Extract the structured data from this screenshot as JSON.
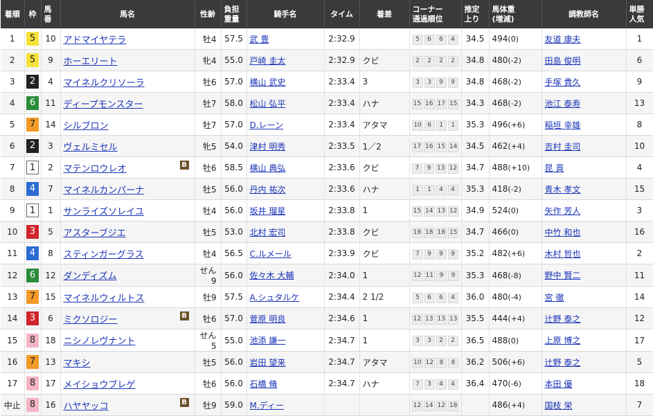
{
  "headers": {
    "rank": "着順",
    "waku": "枠",
    "num": [
      "馬",
      "番"
    ],
    "horse": "馬名",
    "sexage": "性齢",
    "weight": [
      "負担",
      "重量"
    ],
    "jockey": "騎手名",
    "time": "タイム",
    "margin": "着差",
    "corner": [
      "コーナー",
      "通過順位"
    ],
    "last3f": [
      "推定",
      "上り"
    ],
    "bodyw": [
      "馬体重",
      "(増減)"
    ],
    "trainer": "調教師名",
    "pop": [
      "単勝",
      "人気"
    ]
  },
  "blinker_label": "B",
  "rows": [
    {
      "rank": "1",
      "waku": "5",
      "num": "10",
      "horse": "アドマイヤテラ",
      "blinker": false,
      "sexage": "牡4",
      "weight": "57.5",
      "jockey": "武 豊",
      "time": "2:32.9",
      "margin": "",
      "corner": [
        "5",
        "6",
        "6",
        "4"
      ],
      "last3f": "34.5",
      "bodyw": "494",
      "bodyw_diff": "(0)",
      "trainer": "友道 康夫",
      "pop": "1"
    },
    {
      "rank": "2",
      "waku": "5",
      "num": "9",
      "horse": "ホーエリート",
      "blinker": false,
      "sexage": "牝4",
      "weight": "55.0",
      "jockey": "戸崎 圭太",
      "time": "2:32.9",
      "margin": "クビ",
      "corner": [
        "2",
        "2",
        "2",
        "2"
      ],
      "last3f": "34.8",
      "bodyw": "480",
      "bodyw_diff": "(-2)",
      "trainer": "田島 俊明",
      "pop": "6"
    },
    {
      "rank": "3",
      "waku": "2",
      "num": "4",
      "horse": "マイネルクリソーラ",
      "blinker": false,
      "sexage": "牡6",
      "weight": "57.0",
      "jockey": "横山 武史",
      "time": "2:33.4",
      "margin": "3",
      "corner": [
        "3",
        "3",
        "9",
        "9"
      ],
      "last3f": "34.8",
      "bodyw": "468",
      "bodyw_diff": "(-2)",
      "trainer": "手塚 貴久",
      "pop": "9"
    },
    {
      "rank": "4",
      "waku": "6",
      "num": "11",
      "horse": "ディープモンスター",
      "blinker": false,
      "sexage": "牡7",
      "weight": "58.0",
      "jockey": "松山 弘平",
      "time": "2:33.4",
      "margin": "ハナ",
      "corner": [
        "15",
        "16",
        "17",
        "15"
      ],
      "last3f": "34.3",
      "bodyw": "468",
      "bodyw_diff": "(-2)",
      "trainer": "池江 泰寿",
      "pop": "13"
    },
    {
      "rank": "5",
      "waku": "7",
      "num": "14",
      "horse": "シルブロン",
      "blinker": false,
      "sexage": "牡7",
      "weight": "57.0",
      "jockey": "D.レーン",
      "time": "2:33.4",
      "margin": "アタマ",
      "corner": [
        "10",
        "6",
        "1",
        "1"
      ],
      "last3f": "35.3",
      "bodyw": "496",
      "bodyw_diff": "(+6)",
      "trainer": "稲垣 幸雄",
      "pop": "8"
    },
    {
      "rank": "6",
      "waku": "2",
      "num": "3",
      "horse": "ヴェルミセル",
      "blinker": false,
      "sexage": "牝5",
      "weight": "54.0",
      "jockey": "津村 明秀",
      "time": "2:33.5",
      "margin": "1／2",
      "corner": [
        "17",
        "16",
        "15",
        "14"
      ],
      "last3f": "34.5",
      "bodyw": "462",
      "bodyw_diff": "(+4)",
      "trainer": "吉村 圭司",
      "pop": "10"
    },
    {
      "rank": "7",
      "waku": "1",
      "num": "2",
      "horse": "マテンロウレオ",
      "blinker": true,
      "sexage": "牡6",
      "weight": "58.5",
      "jockey": "横山 典弘",
      "time": "2:33.6",
      "margin": "クビ",
      "corner": [
        "7",
        "9",
        "13",
        "12"
      ],
      "last3f": "34.7",
      "bodyw": "488",
      "bodyw_diff": "(+10)",
      "trainer": "昆 貢",
      "pop": "4"
    },
    {
      "rank": "8",
      "waku": "4",
      "num": "7",
      "horse": "マイネルカンパーナ",
      "blinker": false,
      "sexage": "牡5",
      "weight": "56.0",
      "jockey": "丹内 祐次",
      "time": "2:33.6",
      "margin": "ハナ",
      "corner": [
        "1",
        "1",
        "4",
        "4"
      ],
      "last3f": "35.3",
      "bodyw": "418",
      "bodyw_diff": "(-2)",
      "trainer": "青木 孝文",
      "pop": "15"
    },
    {
      "rank": "9",
      "waku": "1",
      "num": "1",
      "horse": "サンライズソレイユ",
      "blinker": false,
      "sexage": "牡4",
      "weight": "56.0",
      "jockey": "坂井 瑠星",
      "time": "2:33.8",
      "margin": "1",
      "corner": [
        "15",
        "14",
        "13",
        "12"
      ],
      "last3f": "34.9",
      "bodyw": "524",
      "bodyw_diff": "(0)",
      "trainer": "矢作 芳人",
      "pop": "3"
    },
    {
      "rank": "10",
      "waku": "3",
      "num": "5",
      "horse": "アスターブジエ",
      "blinker": false,
      "sexage": "牡5",
      "weight": "53.0",
      "jockey": "北村 宏司",
      "time": "2:33.8",
      "margin": "クビ",
      "corner": [
        "18",
        "18",
        "18",
        "15"
      ],
      "last3f": "34.7",
      "bodyw": "466",
      "bodyw_diff": "(0)",
      "trainer": "中竹 和也",
      "pop": "16"
    },
    {
      "rank": "11",
      "waku": "4",
      "num": "8",
      "horse": "スティンガーグラス",
      "blinker": false,
      "sexage": "牡4",
      "weight": "56.5",
      "jockey": "C.ルメール",
      "time": "2:33.9",
      "margin": "クビ",
      "corner": [
        "7",
        "9",
        "9",
        "9"
      ],
      "last3f": "35.2",
      "bodyw": "482",
      "bodyw_diff": "(+6)",
      "trainer": "木村 哲也",
      "pop": "2"
    },
    {
      "rank": "12",
      "waku": "6",
      "num": "12",
      "horse": "ダンディズム",
      "blinker": false,
      "sexage": "せん9",
      "weight": "56.0",
      "jockey": "佐々木 大輔",
      "time": "2:34.0",
      "margin": "1",
      "corner": [
        "12",
        "11",
        "9",
        "9"
      ],
      "last3f": "35.3",
      "bodyw": "468",
      "bodyw_diff": "(-8)",
      "trainer": "野中 賢二",
      "pop": "11"
    },
    {
      "rank": "13",
      "waku": "7",
      "num": "15",
      "horse": "マイネルウィルトス",
      "blinker": false,
      "sexage": "牡9",
      "weight": "57.5",
      "jockey": "A.シュタルケ",
      "time": "2:34.4",
      "margin": "2 1/2",
      "corner": [
        "5",
        "6",
        "6",
        "4"
      ],
      "last3f": "36.0",
      "bodyw": "480",
      "bodyw_diff": "(-4)",
      "trainer": "宮 徹",
      "pop": "14"
    },
    {
      "rank": "14",
      "waku": "3",
      "num": "6",
      "horse": "ミクソロジー",
      "blinker": true,
      "sexage": "牡6",
      "weight": "57.0",
      "jockey": "菅原 明良",
      "time": "2:34.6",
      "margin": "1",
      "corner": [
        "12",
        "13",
        "13",
        "13"
      ],
      "last3f": "35.5",
      "bodyw": "444",
      "bodyw_diff": "(+4)",
      "trainer": "辻野 泰之",
      "pop": "12"
    },
    {
      "rank": "15",
      "waku": "8",
      "num": "18",
      "horse": "ニシノレヴナント",
      "blinker": false,
      "sexage": "せん5",
      "weight": "55.0",
      "jockey": "池添 謙一",
      "time": "2:34.7",
      "margin": "1",
      "corner": [
        "3",
        "3",
        "2",
        "2"
      ],
      "last3f": "36.5",
      "bodyw": "488",
      "bodyw_diff": "(0)",
      "trainer": "上原 博之",
      "pop": "17"
    },
    {
      "rank": "16",
      "waku": "7",
      "num": "13",
      "horse": "マキシ",
      "blinker": false,
      "sexage": "牡5",
      "weight": "56.0",
      "jockey": "岩田 望来",
      "time": "2:34.7",
      "margin": "アタマ",
      "corner": [
        "10",
        "12",
        "8",
        "8"
      ],
      "last3f": "36.2",
      "bodyw": "506",
      "bodyw_diff": "(+6)",
      "trainer": "辻野 泰之",
      "pop": "5"
    },
    {
      "rank": "17",
      "waku": "8",
      "num": "17",
      "horse": "メイショウブレゲ",
      "blinker": false,
      "sexage": "牡6",
      "weight": "56.0",
      "jockey": "石橋 脩",
      "time": "2:34.7",
      "margin": "ハナ",
      "corner": [
        "7",
        "3",
        "4",
        "4"
      ],
      "last3f": "36.4",
      "bodyw": "470",
      "bodyw_diff": "(-6)",
      "trainer": "本田 優",
      "pop": "18"
    },
    {
      "rank": "中止",
      "waku": "8",
      "num": "16",
      "horse": "ハヤヤッコ",
      "blinker": true,
      "sexage": "牡9",
      "weight": "59.0",
      "jockey": "M.ディー",
      "time": "",
      "margin": "",
      "corner": [
        "12",
        "14",
        "12",
        "18"
      ],
      "last3f": "",
      "bodyw": "486",
      "bodyw_diff": "(+4)",
      "trainer": "国枝 栄",
      "pop": "7"
    }
  ]
}
